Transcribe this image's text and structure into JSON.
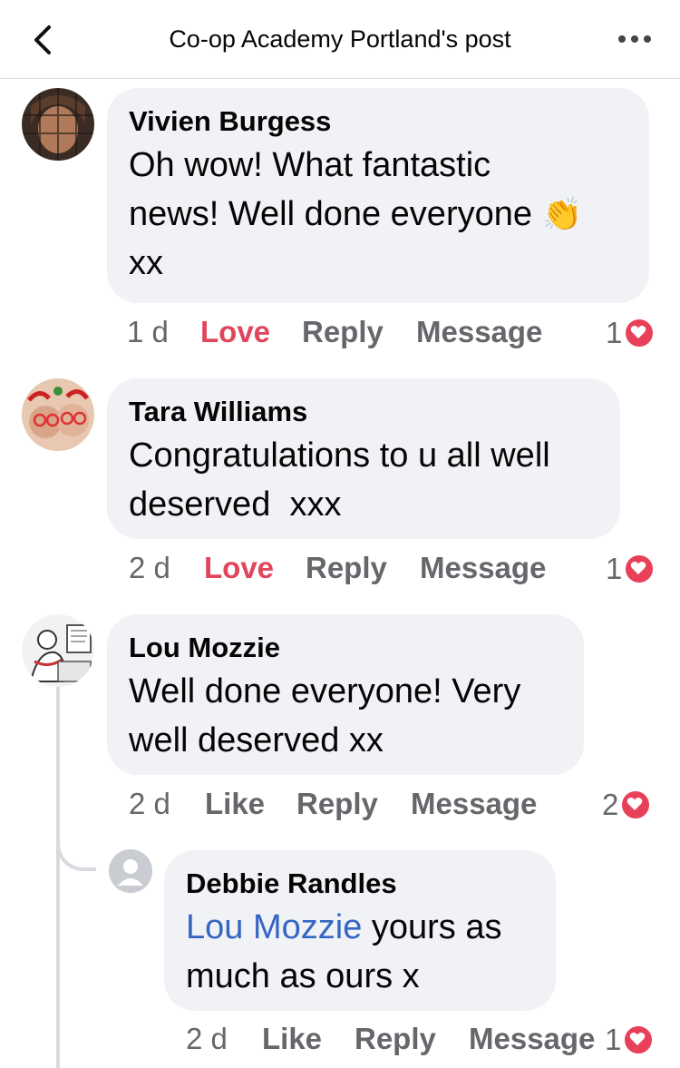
{
  "header": {
    "title": "Co-op Academy Portland's post"
  },
  "comments": [
    {
      "author": "Vivien Burgess",
      "lines": [
        "Oh wow! What fantastic",
        "news! Well done everyone",
        "xx"
      ],
      "emoji": "👏",
      "time": "1 d",
      "like_label": "Love",
      "reply_label": "Reply",
      "message_label": "Message",
      "reaction_count": "1"
    },
    {
      "author": "Tara Williams",
      "lines": [
        "Congratulations to u all well",
        "deserved  xxx"
      ],
      "time": "2 d",
      "like_label": "Love",
      "reply_label": "Reply",
      "message_label": "Message",
      "reaction_count": "1"
    },
    {
      "author": "Lou Mozzie",
      "lines": [
        "Well done everyone! Very",
        "well deserved xx"
      ],
      "time": "2 d",
      "like_label": "Like",
      "reply_label": "Reply",
      "message_label": "Message",
      "reaction_count": "2"
    }
  ],
  "reply": {
    "author": "Debbie Randles",
    "mention": "Lou Mozzie",
    "line1_rest": " yours as",
    "line2": "much as ours x",
    "time": "2 d",
    "like_label": "Like",
    "reply_label": "Reply",
    "message_label": "Message",
    "reaction_count": "1"
  },
  "colors": {
    "love": "#e0455b",
    "mention": "#3565c4",
    "bubble": "#f0f2f5",
    "heart": "#e9405a"
  }
}
